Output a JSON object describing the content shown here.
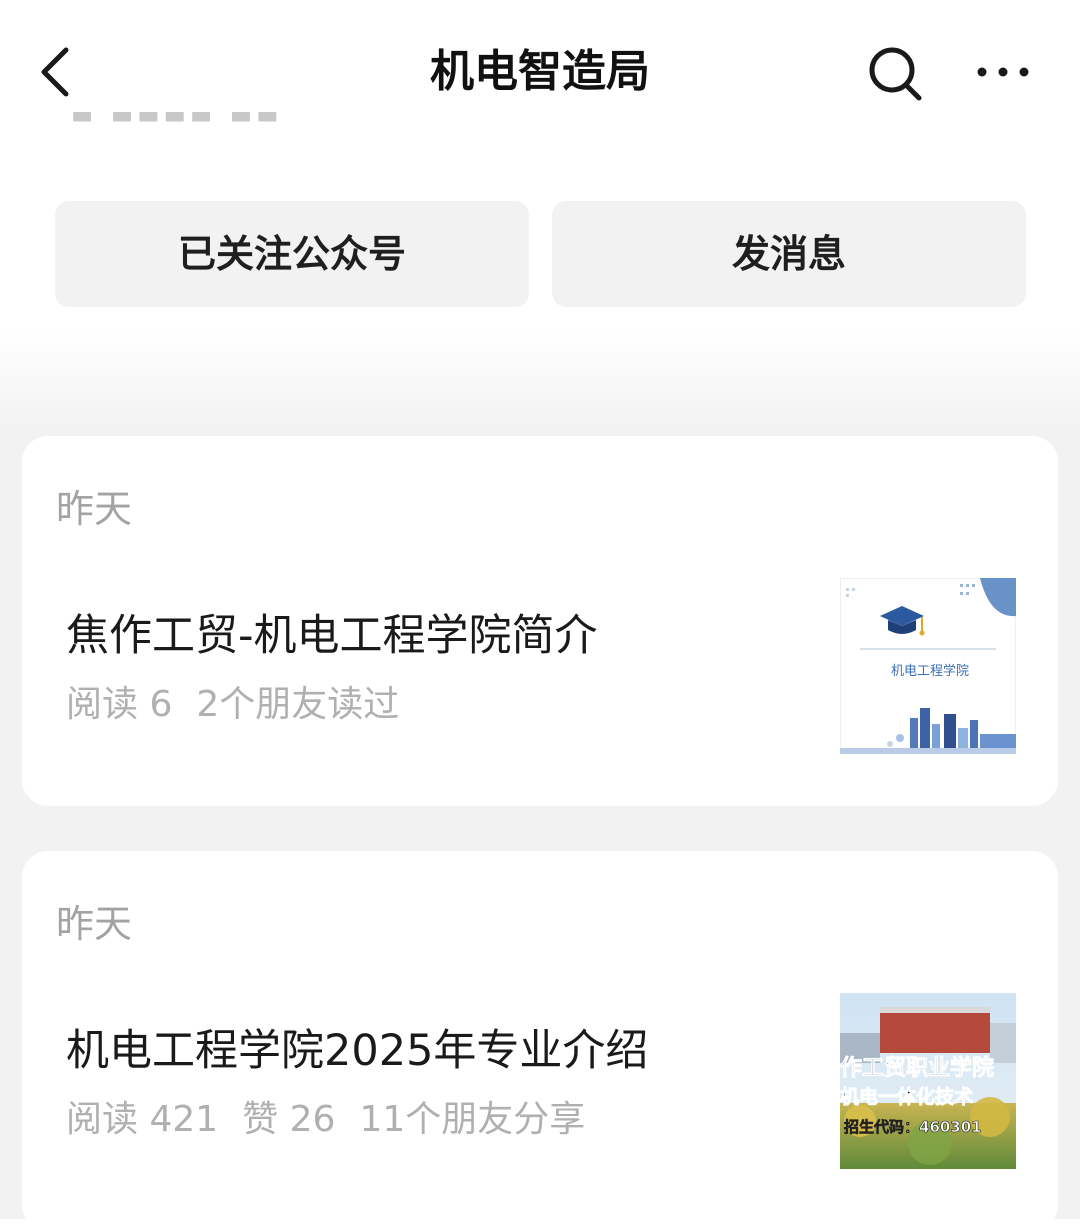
{
  "header": {
    "title": "机电智造局"
  },
  "profile": {
    "follow_label": "已关注公众号",
    "message_label": "发消息"
  },
  "articles": [
    {
      "date": "昨天",
      "title": "焦作工贸-机电工程学院简介",
      "stats": [
        "阅读 6",
        "2个朋友读过"
      ],
      "thumbnail_text": "机电工程学院",
      "thumbnail_icon": "graduation-cap-icon"
    },
    {
      "date": "昨天",
      "title": "机电工程学院2025年专业介绍",
      "stats": [
        "阅读 421",
        "赞 26",
        "11个朋友分享"
      ],
      "thumbnail_lines": [
        "作工贸职业学院",
        "机电一体化技术",
        "招生代码：460301"
      ]
    }
  ],
  "colors": {
    "page_bg": "#f2f2f2",
    "button_bg": "#f2f2f2",
    "meta_text": "#b0b0b0",
    "thumb_accent": "#3a6fb5"
  }
}
